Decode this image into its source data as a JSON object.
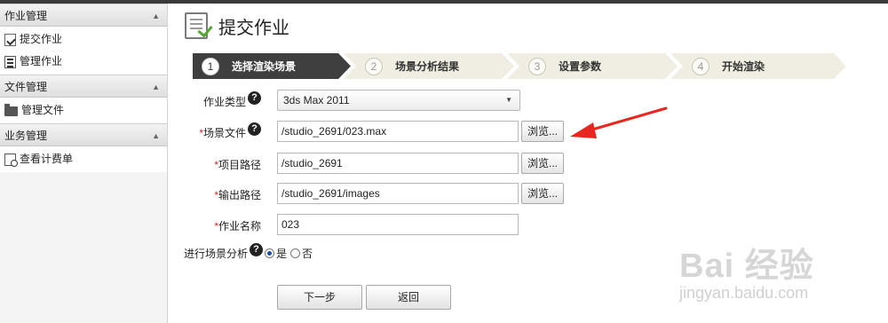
{
  "sidebar": {
    "sections": [
      {
        "title": "作业管理",
        "items": [
          {
            "label": "提交作业",
            "icon": "submit-doc-icon"
          },
          {
            "label": "管理作业",
            "icon": "list-icon"
          }
        ]
      },
      {
        "title": "文件管理",
        "items": [
          {
            "label": "管理文件",
            "icon": "folder-icon"
          }
        ]
      },
      {
        "title": "业务管理",
        "items": [
          {
            "label": "查看计费单",
            "icon": "bill-icon"
          }
        ]
      }
    ]
  },
  "header": {
    "title": "提交作业",
    "icon": "submit-doc-icon"
  },
  "steps": [
    {
      "num": "1",
      "label": "选择渲染场景",
      "active": true
    },
    {
      "num": "2",
      "label": "场景分析结果",
      "active": false
    },
    {
      "num": "3",
      "label": "设置参数",
      "active": false
    },
    {
      "num": "4",
      "label": "开始渲染",
      "active": false
    }
  ],
  "form": {
    "job_type_label": "作业类型",
    "job_type_value": "3ds Max 2011",
    "scene_file_label": "场景文件",
    "scene_file_value": "/studio_2691/023.max",
    "project_path_label": "项目路径",
    "project_path_value": "/studio_2691",
    "output_path_label": "输出路径",
    "output_path_value": "/studio_2691/images",
    "job_name_label": "作业名称",
    "job_name_value": "023",
    "analyze_label": "进行场景分析",
    "yes_label": "是",
    "no_label": "否",
    "required_mark": "*",
    "help_mark": "?",
    "browse_label": "浏览...",
    "next_label": "下一步",
    "back_label": "返回"
  },
  "watermark": {
    "logo": "Bai 经验",
    "url": "jingyan.baidu.com"
  },
  "colors": {
    "accent_red": "#e8251f",
    "required_red": "#d9261c",
    "active_step": "#3f3f3f",
    "inactive_step": "#f0eee2"
  }
}
